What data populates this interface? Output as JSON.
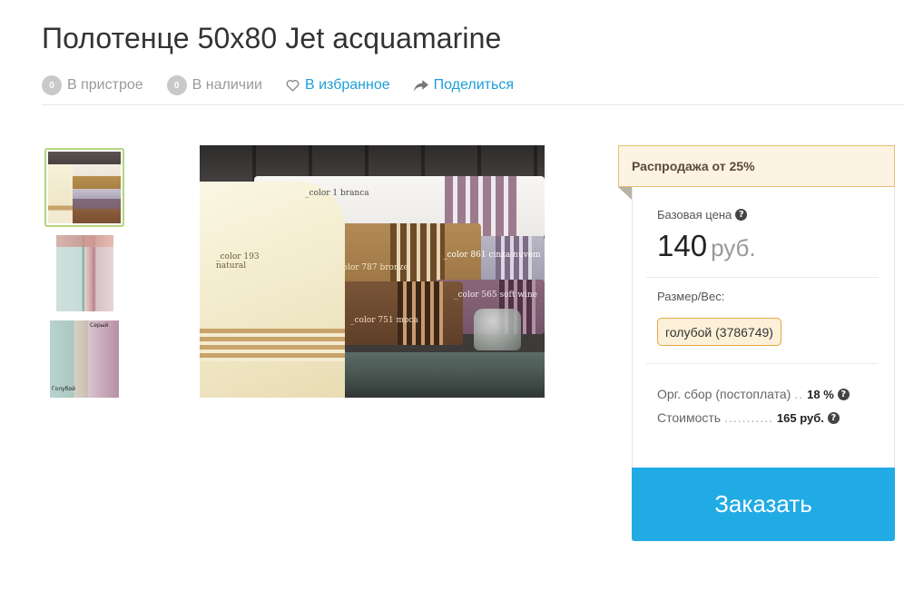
{
  "product": {
    "title": "Полотенце 50x80 Jet acquamarine"
  },
  "meta": {
    "pre_order_count": "0",
    "pre_order_label": "В пристрое",
    "in_stock_count": "0",
    "in_stock_label": "В наличии",
    "favorite_label": "В избранное",
    "favorite_icon": "heart-outline-icon",
    "share_label": "Поделиться",
    "share_icon": "share-arrow-icon",
    "link_color": "#1e9fd8"
  },
  "gallery": {
    "thumbnail_labels": [
      "Серый",
      "Голубой"
    ],
    "main_photo_labels": [
      "_color 1 branca",
      "_color 193 natural",
      "_color 787 bronze",
      "_color 861 cinza nuvem",
      "_color 565 soft wine",
      "_color 751 moca"
    ]
  },
  "offer": {
    "sale_banner": "Распродажа от 25%",
    "base_price_label": "Базовая цена",
    "price": "140",
    "currency": "руб.",
    "size_label": "Размер/Вес:",
    "size_option": "голубой (3786749)",
    "fee_label": "Орг. сбор (постоплата)",
    "fee_value": "18 %",
    "cost_label": "Стоимость",
    "cost_value": "165 руб.",
    "order_button": "Заказать",
    "order_button_color": "#21abe5",
    "sale_banner_border_color": "#e8c073"
  }
}
